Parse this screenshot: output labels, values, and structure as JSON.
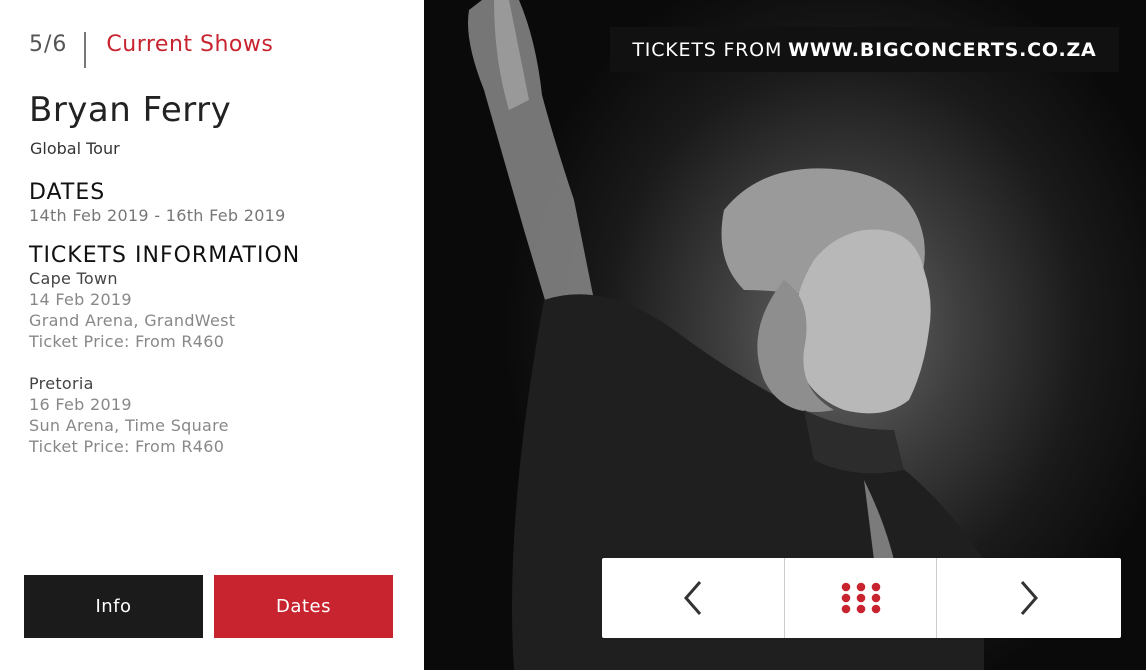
{
  "header": {
    "counter": "5/6",
    "section_title": "Current Shows"
  },
  "show": {
    "title": "Bryan Ferry",
    "subtitle": "Global Tour"
  },
  "dates": {
    "heading": "DATES",
    "range": "14th Feb 2019 - 16th Feb 2019"
  },
  "tickets": {
    "heading": "TICKETS INFORMATION",
    "venues": [
      {
        "city": "Cape Town",
        "date": "14 Feb 2019",
        "venue": "Grand Arena, GrandWest",
        "price": "Ticket Price: From R460"
      },
      {
        "city": "Pretoria",
        "date": "16 Feb 2019",
        "venue": "Sun Arena, Time Square",
        "price": "Ticket Price: From R460"
      }
    ]
  },
  "tabs": {
    "info_label": "Info",
    "dates_label": "Dates"
  },
  "banner": {
    "prefix": "TICKETS FROM",
    "url": "WWW.BIGCONCERTS.CO.ZA"
  },
  "navigation": {
    "prev_icon": "chevron-left-icon",
    "grid_icon": "grid-dots-icon",
    "next_icon": "chevron-right-icon"
  },
  "colors": {
    "accent": "#c8242f",
    "dark": "#1b1b1b"
  }
}
